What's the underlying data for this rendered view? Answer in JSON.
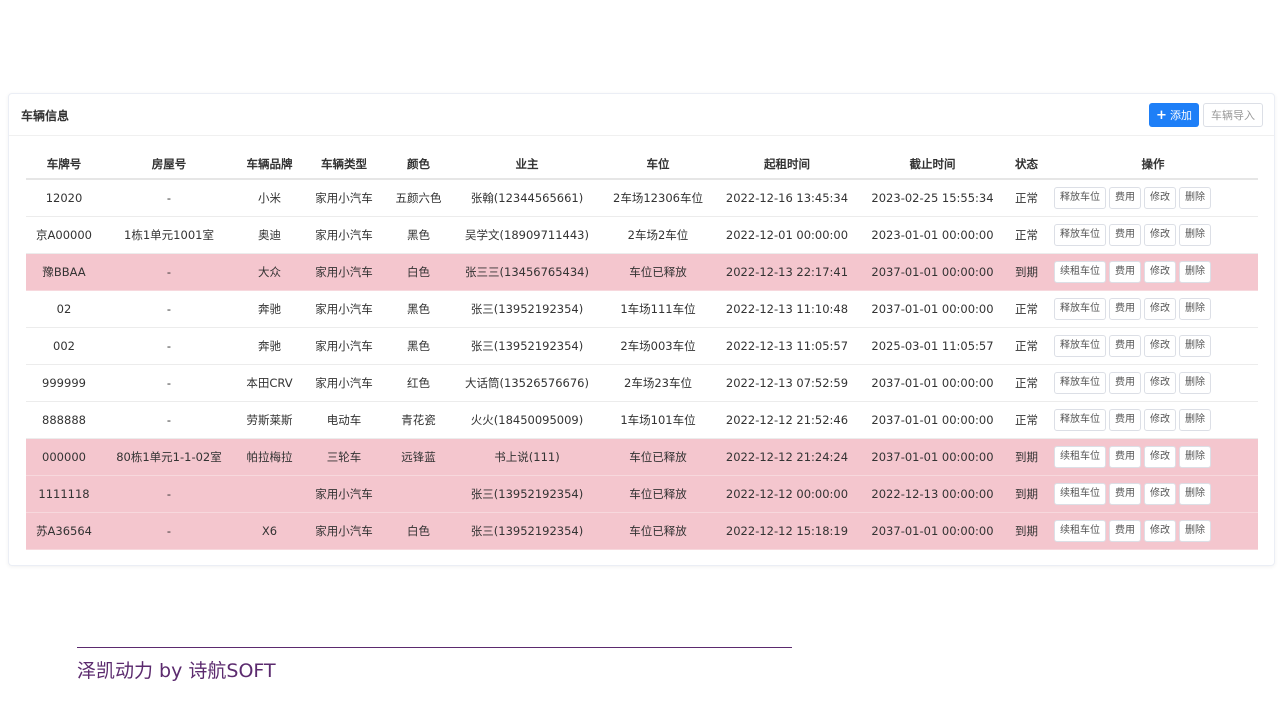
{
  "panel": {
    "title": "车辆信息",
    "add_label": "添加",
    "add_icon": "plus-icon",
    "import_label": "车辆导入"
  },
  "table": {
    "headers": [
      "车牌号",
      "房屋号",
      "车辆品牌",
      "车辆类型",
      "颜色",
      "业主",
      "车位",
      "起租时间",
      "截止时间",
      "状态",
      "操作"
    ],
    "rows": [
      {
        "plate": "12020",
        "house": "-",
        "brand": "小米",
        "type": "家用小汽车",
        "color": "五颜六色",
        "owner": "张翰(12344565661)",
        "spot": "2车场12306车位",
        "start": "2022-12-16 13:45:34",
        "end": "2023-02-25 15:55:34",
        "status": "正常",
        "expired": false,
        "op1": "释放车位",
        "op2": "费用",
        "op3": "修改",
        "op4": "删除"
      },
      {
        "plate": "京A00000",
        "house": "1栋1单元1001室",
        "brand": "奥迪",
        "type": "家用小汽车",
        "color": "黑色",
        "owner": "吴学文(18909711443)",
        "spot": "2车场2车位",
        "start": "2022-12-01 00:00:00",
        "end": "2023-01-01 00:00:00",
        "status": "正常",
        "expired": false,
        "op1": "释放车位",
        "op2": "费用",
        "op3": "修改",
        "op4": "删除"
      },
      {
        "plate": "豫BBAA",
        "house": "-",
        "brand": "大众",
        "type": "家用小汽车",
        "color": "白色",
        "owner": "张三三(13456765434)",
        "spot": "车位已释放",
        "start": "2022-12-13 22:17:41",
        "end": "2037-01-01 00:00:00",
        "status": "到期",
        "expired": true,
        "op1": "续租车位",
        "op2": "费用",
        "op3": "修改",
        "op4": "删除"
      },
      {
        "plate": "02",
        "house": "-",
        "brand": "奔驰",
        "type": "家用小汽车",
        "color": "黑色",
        "owner": "张三(13952192354)",
        "spot": "1车场111车位",
        "start": "2022-12-13 11:10:48",
        "end": "2037-01-01 00:00:00",
        "status": "正常",
        "expired": false,
        "op1": "释放车位",
        "op2": "费用",
        "op3": "修改",
        "op4": "删除"
      },
      {
        "plate": "002",
        "house": "-",
        "brand": "奔驰",
        "type": "家用小汽车",
        "color": "黑色",
        "owner": "张三(13952192354)",
        "spot": "2车场003车位",
        "start": "2022-12-13 11:05:57",
        "end": "2025-03-01 11:05:57",
        "status": "正常",
        "expired": false,
        "op1": "释放车位",
        "op2": "费用",
        "op3": "修改",
        "op4": "删除"
      },
      {
        "plate": "999999",
        "house": "-",
        "brand": "本田CRV",
        "type": "家用小汽车",
        "color": "红色",
        "owner": "大话筒(13526576676)",
        "spot": "2车场23车位",
        "start": "2022-12-13 07:52:59",
        "end": "2037-01-01 00:00:00",
        "status": "正常",
        "expired": false,
        "op1": "释放车位",
        "op2": "费用",
        "op3": "修改",
        "op4": "删除"
      },
      {
        "plate": "888888",
        "house": "-",
        "brand": "劳斯莱斯",
        "type": "电动车",
        "color": "青花瓷",
        "owner": "火火(18450095009)",
        "spot": "1车场101车位",
        "start": "2022-12-12 21:52:46",
        "end": "2037-01-01 00:00:00",
        "status": "正常",
        "expired": false,
        "op1": "释放车位",
        "op2": "费用",
        "op3": "修改",
        "op4": "删除"
      },
      {
        "plate": "000000",
        "house": "80栋1单元1-1-02室",
        "brand": "帕拉梅拉",
        "type": "三轮车",
        "color": "远锋蓝",
        "owner": "书上说(111)",
        "spot": "车位已释放",
        "start": "2022-12-12 21:24:24",
        "end": "2037-01-01 00:00:00",
        "status": "到期",
        "expired": true,
        "op1": "续租车位",
        "op2": "费用",
        "op3": "修改",
        "op4": "删除"
      },
      {
        "plate": "1111118",
        "house": "-",
        "brand": "",
        "type": "家用小汽车",
        "color": "",
        "owner": "张三(13952192354)",
        "spot": "车位已释放",
        "start": "2022-12-12 00:00:00",
        "end": "2022-12-13 00:00:00",
        "status": "到期",
        "expired": true,
        "op1": "续租车位",
        "op2": "费用",
        "op3": "修改",
        "op4": "删除"
      },
      {
        "plate": "苏A36564",
        "house": "-",
        "brand": "X6",
        "type": "家用小汽车",
        "color": "白色",
        "owner": "张三(13952192354)",
        "spot": "车位已释放",
        "start": "2022-12-12 15:18:19",
        "end": "2037-01-01 00:00:00",
        "status": "到期",
        "expired": true,
        "op1": "续租车位",
        "op2": "费用",
        "op3": "修改",
        "op4": "删除"
      }
    ]
  },
  "footer": {
    "text": "泽凯动力 by 诗航SOFT"
  },
  "colors": {
    "primary": "#1e7ff7",
    "expired_row": "#f4c6ce",
    "footer": "#5b2a6e"
  }
}
